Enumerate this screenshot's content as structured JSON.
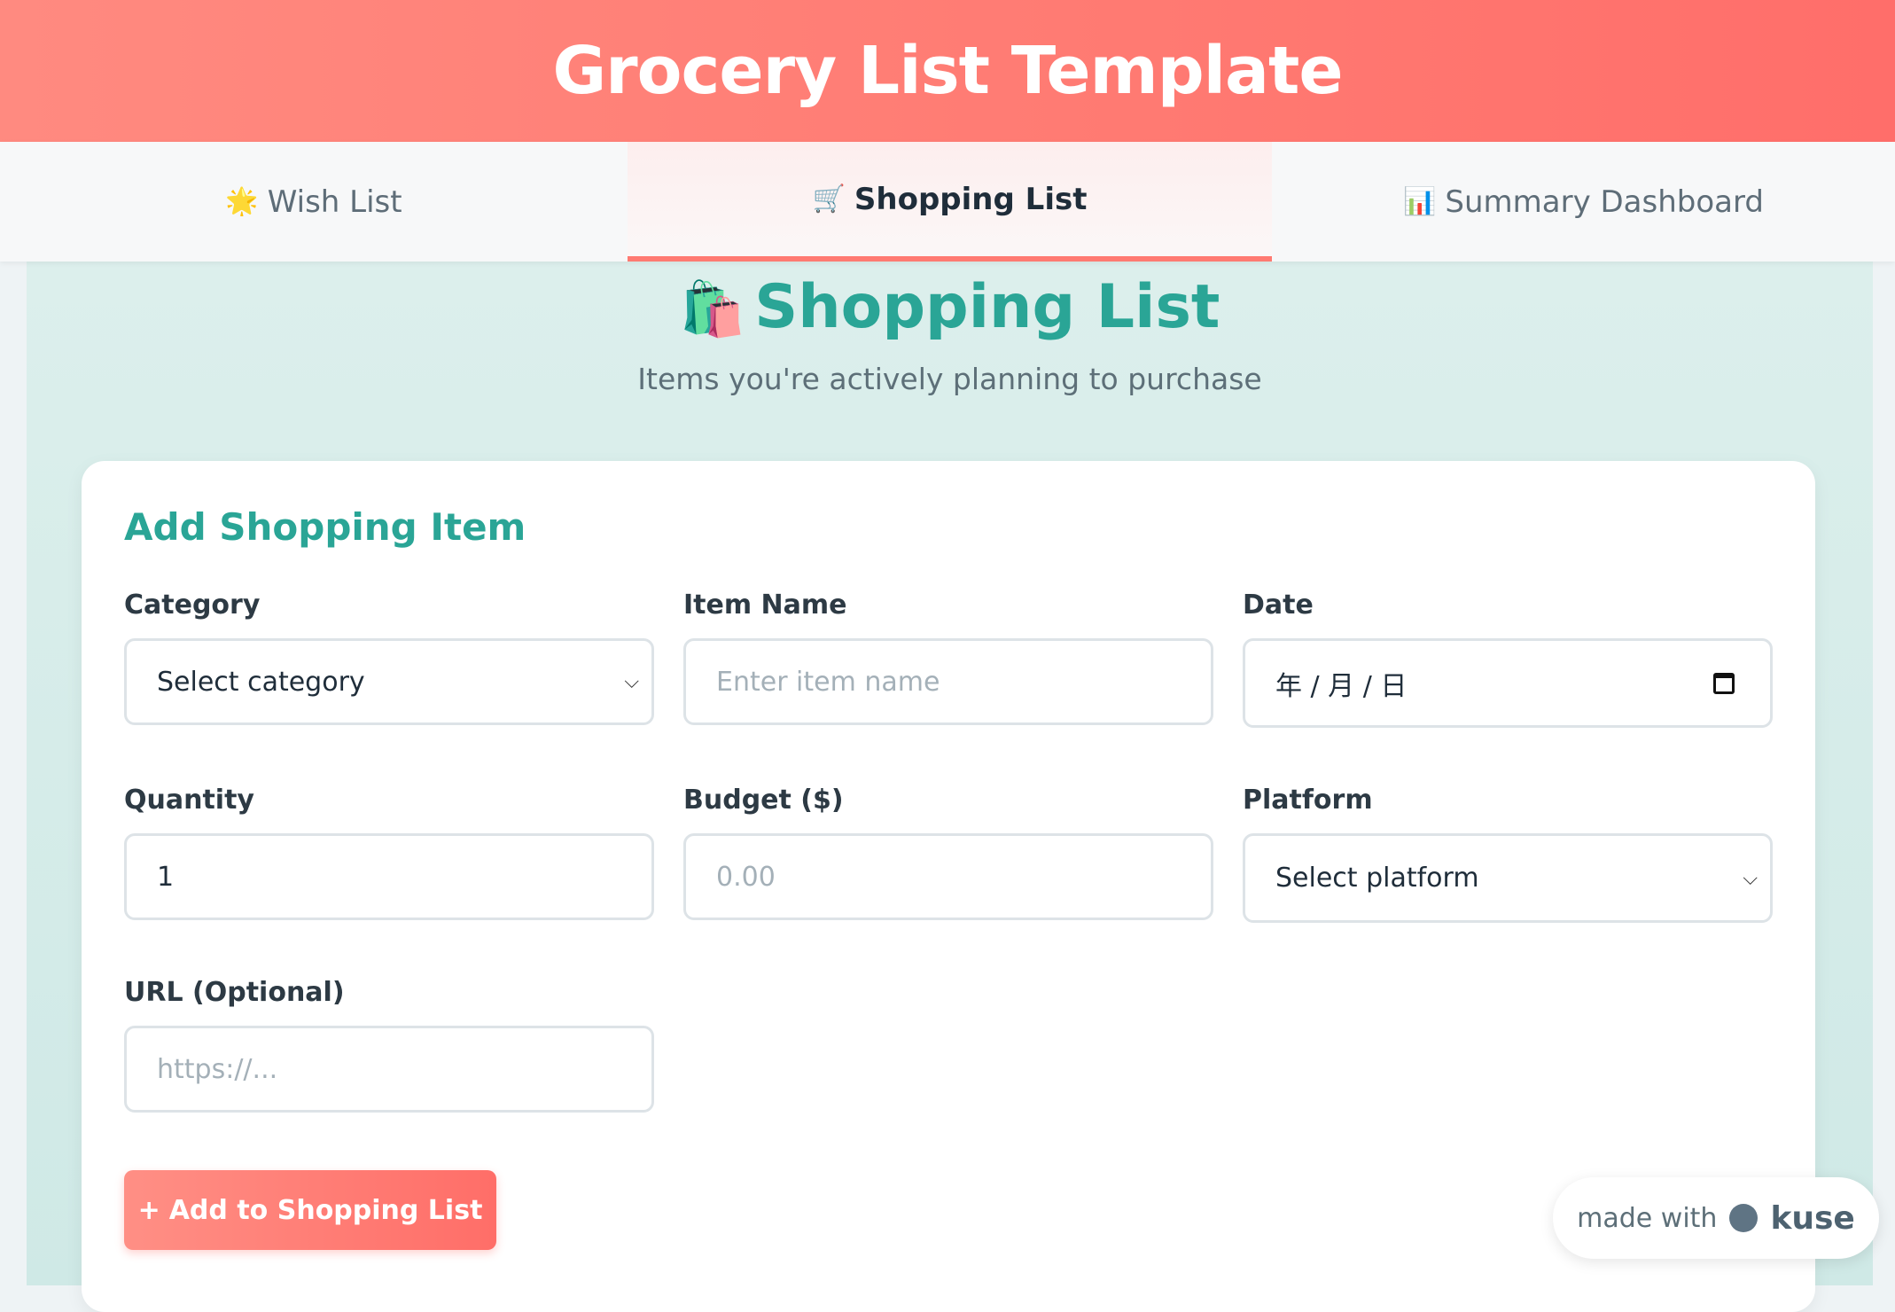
{
  "header": {
    "title": "Grocery List Template"
  },
  "tabs": [
    {
      "icon": "🌟",
      "label": "Wish List",
      "active": false
    },
    {
      "icon": "🛒",
      "label": "Shopping List",
      "active": true
    },
    {
      "icon": "📊",
      "label": "Summary Dashboard",
      "active": false
    }
  ],
  "section": {
    "icon": "🛍️",
    "title": "Shopping List",
    "subtitle": "Items you're actively planning to purchase"
  },
  "form": {
    "title": "Add Shopping Item",
    "category": {
      "label": "Category",
      "value": "Select category"
    },
    "item_name": {
      "label": "Item Name",
      "placeholder": "Enter item name"
    },
    "date": {
      "label": "Date",
      "value": "年 / 月 / 日"
    },
    "quantity": {
      "label": "Quantity",
      "value": "1"
    },
    "budget": {
      "label": "Budget ($)",
      "placeholder": "0.00"
    },
    "platform": {
      "label": "Platform",
      "value": "Select platform"
    },
    "url": {
      "label": "URL (Optional)",
      "placeholder": "https://..."
    },
    "submit": {
      "icon": "+",
      "label": "Add to Shopping List"
    }
  },
  "badge": {
    "text": "made with",
    "brand": "kuse"
  },
  "colors": {
    "accent": "#ff7a72",
    "teal": "#2aa596",
    "bg_teal": "#d4ece9"
  }
}
